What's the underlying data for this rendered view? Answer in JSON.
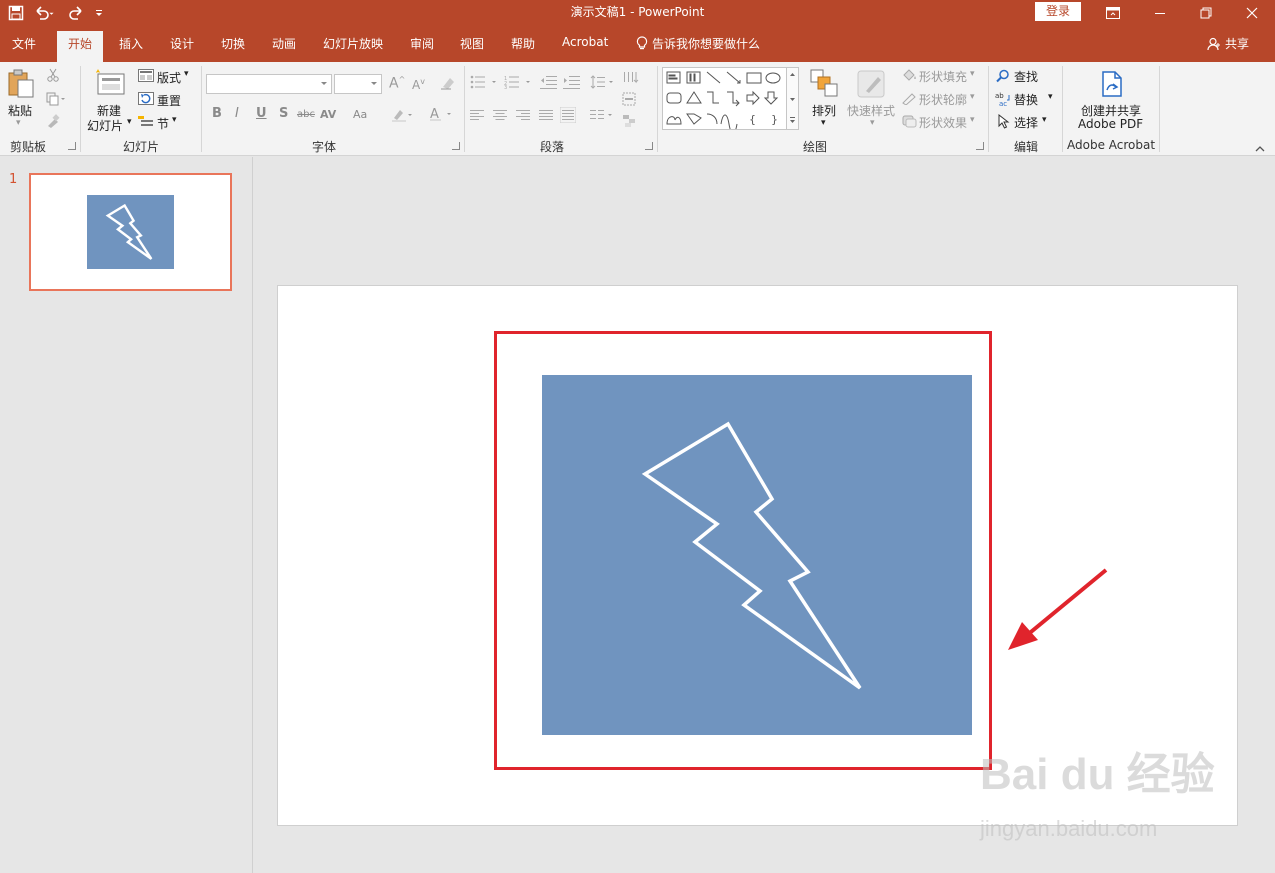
{
  "window": {
    "title": "演示文稿1  -  PowerPoint",
    "login_label": "登录"
  },
  "tabs": [
    "文件",
    "开始",
    "插入",
    "设计",
    "切换",
    "动画",
    "幻灯片放映",
    "审阅",
    "视图",
    "帮助",
    "Acrobat"
  ],
  "active_tab": "开始",
  "tell_me": "告诉我你想要做什么",
  "share_label": "共享",
  "ribbon": {
    "clipboard": {
      "paste": "粘贴",
      "label": "剪贴板"
    },
    "slides": {
      "new_slide_1": "新建",
      "new_slide_2": "幻灯片",
      "layout": "版式",
      "reset": "重置",
      "section": "节",
      "label": "幻灯片"
    },
    "font": {
      "label": "字体",
      "bold": "B",
      "italic": "I",
      "underline": "U",
      "shadow": "S",
      "strike": "abc",
      "spacing": "AV",
      "case": "Aa"
    },
    "paragraph": {
      "label": "段落"
    },
    "drawing": {
      "arrange": "排列",
      "quick_styles": "快速样式",
      "shape_fill": "形状填充",
      "shape_outline": "形状轮廓",
      "shape_effects": "形状效果",
      "label": "绘图"
    },
    "editing": {
      "find": "查找",
      "replace": "替换",
      "select": "选择",
      "label": "编辑"
    },
    "acrobat": {
      "create_1": "创建并共享",
      "create_2": "Adobe PDF",
      "label": "Adobe Acrobat"
    }
  },
  "slides_panel": {
    "slide_number": "1"
  },
  "watermark": {
    "logo": "Bai du 经验",
    "url": "jingyan.baidu.com"
  },
  "colors": {
    "accent": "#b7472a",
    "picture_fill": "#7094bf",
    "highlight_red": "#e0242c",
    "thumb_border": "#e9755a"
  }
}
